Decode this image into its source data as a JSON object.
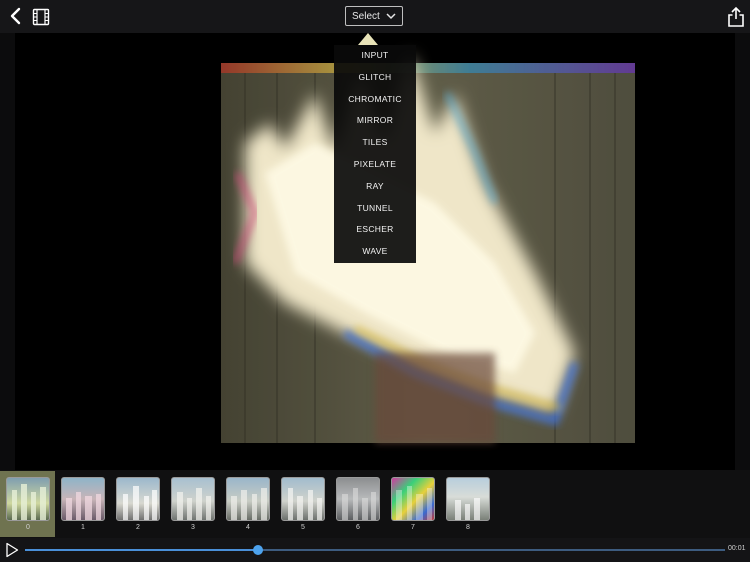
{
  "header": {
    "select_label": "Select"
  },
  "effects_menu": {
    "items": [
      "INPUT",
      "GLITCH",
      "CHROMATIC",
      "MIRROR",
      "TILES",
      "PIXELATE",
      "RAY",
      "TUNNEL",
      "ESCHER",
      "WAVE"
    ]
  },
  "filmstrip": {
    "selected_index": 0,
    "frames": [
      {
        "label": "0"
      },
      {
        "label": "1"
      },
      {
        "label": "2"
      },
      {
        "label": "3"
      },
      {
        "label": "4"
      },
      {
        "label": "5"
      },
      {
        "label": "6"
      },
      {
        "label": "7"
      },
      {
        "label": "8"
      }
    ]
  },
  "playback": {
    "progress_fraction": 0.333,
    "time": "00:01"
  },
  "colors": {
    "accent": "#4da3ee",
    "selected_frame": "#6f7350"
  }
}
